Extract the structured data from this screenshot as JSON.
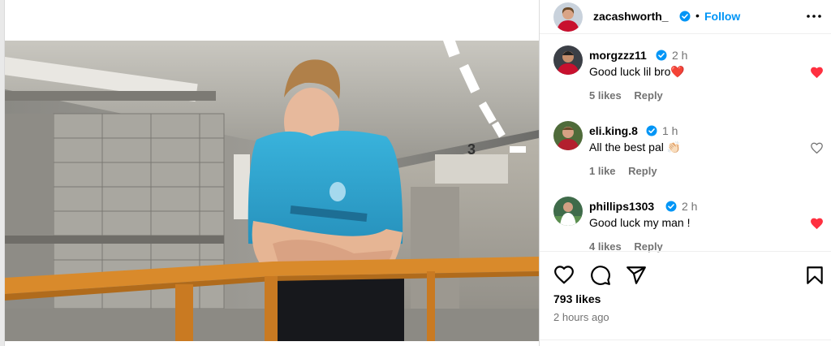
{
  "post": {
    "author": "zacashworth_",
    "verified": true,
    "separator": "•",
    "follow_label": "Follow",
    "more_icon": "more-horizontal-icon",
    "likes": "793 likes",
    "time_ago": "2 hours ago"
  },
  "comments": [
    {
      "user": "morgzzz11",
      "verified": true,
      "time": "2 h",
      "text": "Good luck lil bro",
      "emoji": "❤️",
      "likes": "5 likes",
      "reply": "Reply",
      "liked": true
    },
    {
      "user": "eli.king.8",
      "verified": true,
      "time": "1 h",
      "text": "All the best pal",
      "emoji": "👏🏻",
      "likes": "1 like",
      "reply": "Reply",
      "liked": false
    },
    {
      "user": "phillips1303",
      "verified": true,
      "time": "2 h",
      "text": "Good luck my man !",
      "emoji": "",
      "likes": "4 likes",
      "reply": "Reply",
      "liked": true
    }
  ],
  "colors": {
    "accent": "#0095f6",
    "verified": "#0095f6",
    "like_red": "#ff3040",
    "muted": "#737373",
    "jersey": "#2fa4cf",
    "railing": "#d98a2b"
  },
  "icons": [
    "heart-icon",
    "comment-icon",
    "share-icon",
    "save-bookmark-icon",
    "verified-badge-icon"
  ]
}
